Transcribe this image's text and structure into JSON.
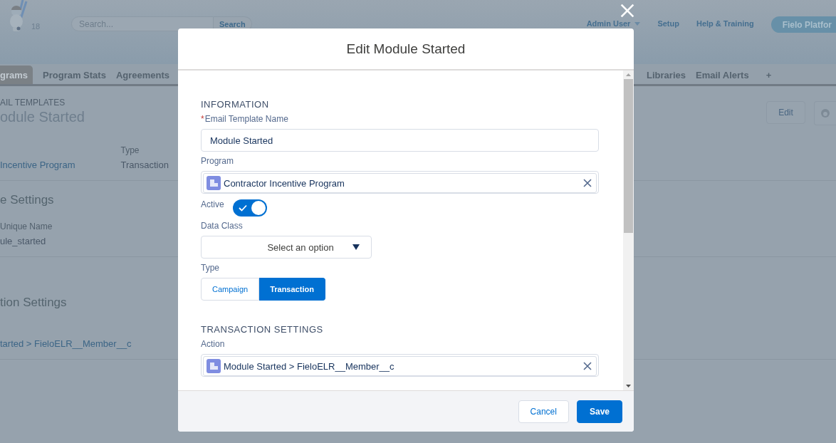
{
  "header": {
    "notification_count": "18",
    "search": {
      "placeholder": "Search...",
      "button": "Search"
    },
    "links": [
      {
        "label": "Admin User",
        "kind": "menu"
      },
      {
        "label": "Setup",
        "kind": "link"
      },
      {
        "label": "Help & Training",
        "kind": "link"
      }
    ],
    "app_button": "Fielo Platfor"
  },
  "tabs": [
    {
      "label": "grams",
      "selected": true
    },
    {
      "label": "Program Stats",
      "selected": false
    },
    {
      "label": "Agreements",
      "selected": false
    }
  ],
  "more_tabs": [
    {
      "label": "Libraries",
      "selected": false
    },
    {
      "label": "Email Alerts",
      "selected": false
    }
  ],
  "add_tab": "+",
  "record": {
    "object_label": "AIL TEMPLATES",
    "title": "odule Started",
    "actions": [
      "Edit"
    ],
    "highlights": [
      {
        "value": "Incentive Program",
        "link": true
      },
      {
        "label": "Type",
        "value": "Transaction",
        "link": false
      }
    ],
    "sections": [
      {
        "title": "e Settings",
        "fields": [
          {
            "label": "Unique Name",
            "value": "ule_started",
            "link": false
          }
        ]
      },
      {
        "title": "tion Settings",
        "fields": [
          {
            "value": "tarted > FieloELR__Member__c",
            "link": true
          }
        ]
      }
    ]
  },
  "modal": {
    "title": "Edit Module Started",
    "sections": [
      {
        "title": "INFORMATION",
        "fields": [
          {
            "kind": "text",
            "label": "Email Template Name",
            "required_mark": "*",
            "value": "Module Started"
          },
          {
            "kind": "lookup",
            "label": "Program",
            "value": "Contractor Incentive Program"
          },
          {
            "kind": "toggle",
            "label": "Active",
            "on": true
          },
          {
            "kind": "select",
            "label": "Data Class",
            "placeholder": "Select an option"
          },
          {
            "kind": "segmented",
            "label": "Type",
            "options": [
              {
                "label": "Campaign",
                "selected": false
              },
              {
                "label": "Transaction",
                "selected": true
              }
            ]
          }
        ]
      },
      {
        "title": "TRANSACTION SETTINGS",
        "fields": [
          {
            "kind": "lookup",
            "label": "Action",
            "value": "Module Started > FieloELR__Member__c"
          }
        ]
      }
    ],
    "buttons": [
      {
        "label": "Cancel",
        "kind": "neutral"
      },
      {
        "label": "Save",
        "kind": "brand"
      }
    ]
  }
}
